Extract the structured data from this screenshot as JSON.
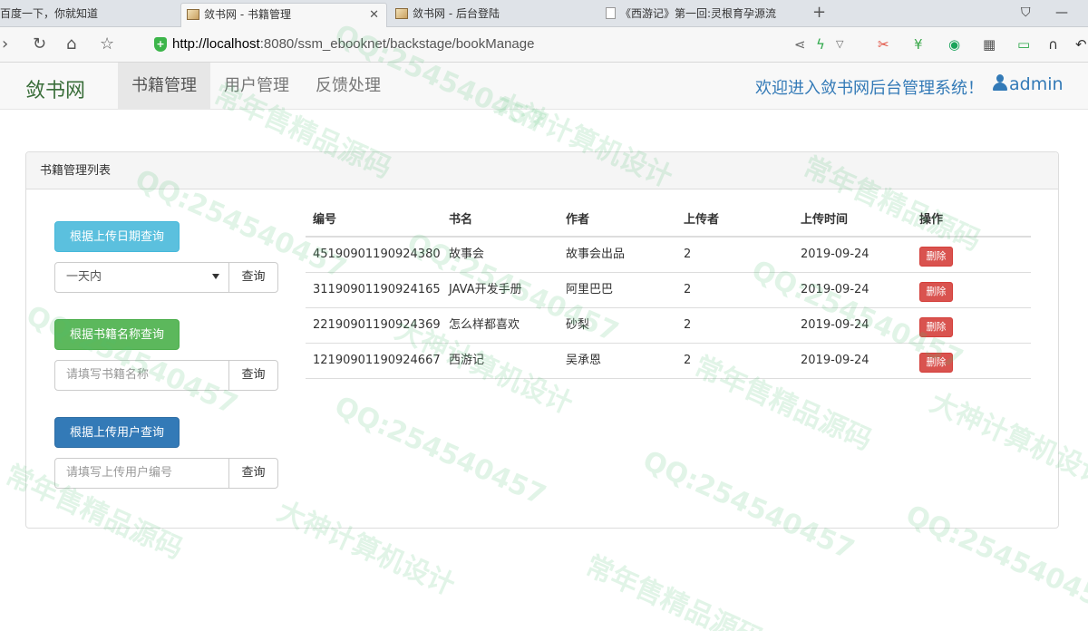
{
  "browser": {
    "tabs": [
      {
        "label": "百度一下，你就知道"
      },
      {
        "label": "敛书网 - 书籍管理"
      },
      {
        "label": "敛书网 - 后台登陆"
      },
      {
        "label": "《西游记》第一回:灵根育孕源流"
      }
    ],
    "url_host": "http://localhost",
    "url_rest": ":8080/ssm_ebooknet/backstage/bookManage"
  },
  "navbar": {
    "brand": "敛书网",
    "links": [
      "书籍管理",
      "用户管理",
      "反馈处理"
    ],
    "welcome": "欢迎进入敛书网后台管理系统！",
    "user": "admin"
  },
  "panel": {
    "title": "书籍管理列表",
    "date_query": {
      "button": "根据上传日期查询",
      "selected": "一天内",
      "submit": "查询"
    },
    "name_query": {
      "button": "根据书籍名称查询",
      "placeholder": "请填写书籍名称",
      "submit": "查询"
    },
    "user_query": {
      "button": "根据上传用户查询",
      "placeholder": "请填写上传用户编号",
      "submit": "查询"
    }
  },
  "table": {
    "headers": [
      "编号",
      "书名",
      "作者",
      "上传者",
      "上传时间",
      "操作"
    ],
    "rows": [
      {
        "id": "45190901190924380",
        "name": "故事会",
        "author": "故事会出品",
        "uploader": "2",
        "time": "2019-09-24",
        "action": "删除"
      },
      {
        "id": "31190901190924165",
        "name": "JAVA开发手册",
        "author": "阿里巴巴",
        "uploader": "2",
        "time": "2019-09-24",
        "action": "删除"
      },
      {
        "id": "22190901190924369",
        "name": "怎么样都喜欢",
        "author": "砂梨",
        "uploader": "2",
        "time": "2019-09-24",
        "action": "删除"
      },
      {
        "id": "12190901190924667",
        "name": "西游记",
        "author": "吴承恩",
        "uploader": "2",
        "time": "2019-09-24",
        "action": "删除"
      }
    ]
  },
  "watermark": {
    "lines": [
      "QQ:254540457",
      "大神计算机设计",
      "常年售精品源码"
    ]
  }
}
